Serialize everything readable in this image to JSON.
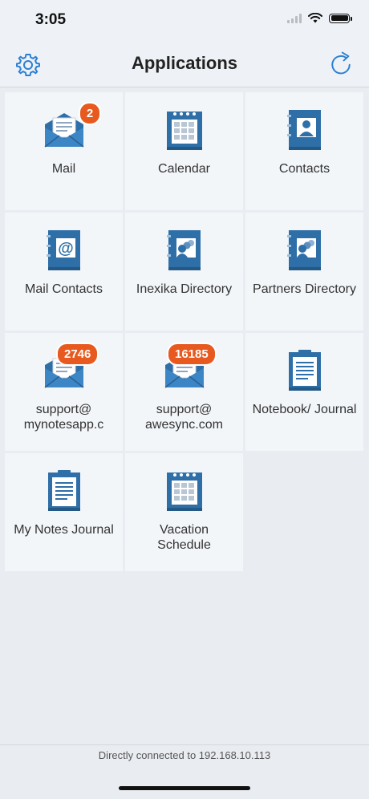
{
  "status_bar": {
    "time": "3:05"
  },
  "nav": {
    "title": "Applications",
    "left_icon": "gear-icon",
    "right_icon": "refresh-icon"
  },
  "apps": [
    {
      "label": "Mail",
      "icon": "mail-icon",
      "badge": "2"
    },
    {
      "label": "Calendar",
      "icon": "calendar-icon"
    },
    {
      "label": "Contacts",
      "icon": "contacts-icon"
    },
    {
      "label": "Mail Contacts",
      "icon": "mail-contacts-icon"
    },
    {
      "label": "Inexika Directory",
      "icon": "directory-icon"
    },
    {
      "label": "Partners Directory",
      "icon": "directory-icon"
    },
    {
      "label": "support@ mynotesapp.c",
      "icon": "mail-icon",
      "badge": "2746"
    },
    {
      "label": "support@ awesync.com",
      "icon": "mail-icon",
      "badge": "16185"
    },
    {
      "label": "Notebook/ Journal",
      "icon": "notebook-icon"
    },
    {
      "label": "My Notes Journal",
      "icon": "notebook-icon"
    },
    {
      "label": "Vacation Schedule",
      "icon": "calendar-icon"
    }
  ],
  "footer": {
    "status": "Directly connected to 192.168.10.113"
  },
  "colors": {
    "accent": "#2d7fd3",
    "badge": "#e8591f",
    "icon_blue": "#2f6fa8"
  }
}
